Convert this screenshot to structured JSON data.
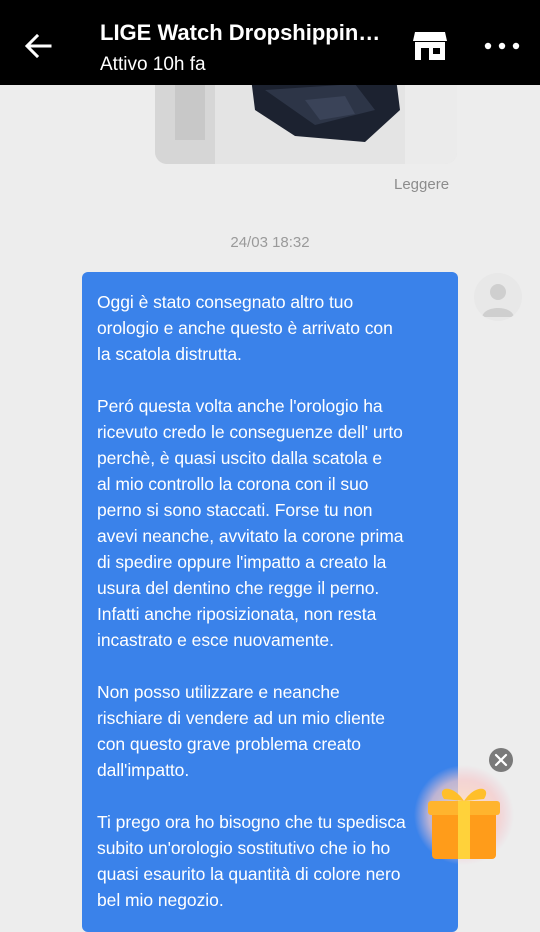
{
  "header": {
    "title": "LIGE Watch Dropshippin…",
    "status": "Attivo 10h fa"
  },
  "icons": {
    "back": "arrow-left-icon",
    "store": "store-icon",
    "more": "more-dots-icon",
    "avatar": "person-icon",
    "close": "close-icon",
    "gift": "gift-icon"
  },
  "previous_message": {
    "read_status": "Leggere"
  },
  "timestamp": "24/03 18:32",
  "message": {
    "paragraphs": [
      "Oggi è stato consegnato altro tuo\norologio e anche questo è arrivato con\nla scatola distrutta.",
      "Peró questa volta anche l'orologio ha\nricevuto credo le conseguenze dell' urto\nperchè, è quasi uscito dalla scatola  e\nal mio controllo la corona con il suo\nperno si sono staccati. Forse tu non\navevi neanche, avvitato la corone prima\ndi spedire oppure l'impatto a creato la\nusura del dentino che regge il perno.\nInfatti anche riposizionata, non resta\nincastrato e esce nuovamente.",
      "Non posso utilizzare e neanche\nrischiare di vendere ad un mio cliente\ncon questo grave problema creato\ndall'impatto.",
      "Ti prego ora ho bisogno che tu spedisca\nsubito un'orologio sostitutivo che io ho\nquasi esaurito la quantità di colore nero\nbel mio negozio."
    ]
  },
  "colors": {
    "header_bg": "#000000",
    "bubble_bg": "#3a82ea",
    "page_bg": "#ededed"
  }
}
